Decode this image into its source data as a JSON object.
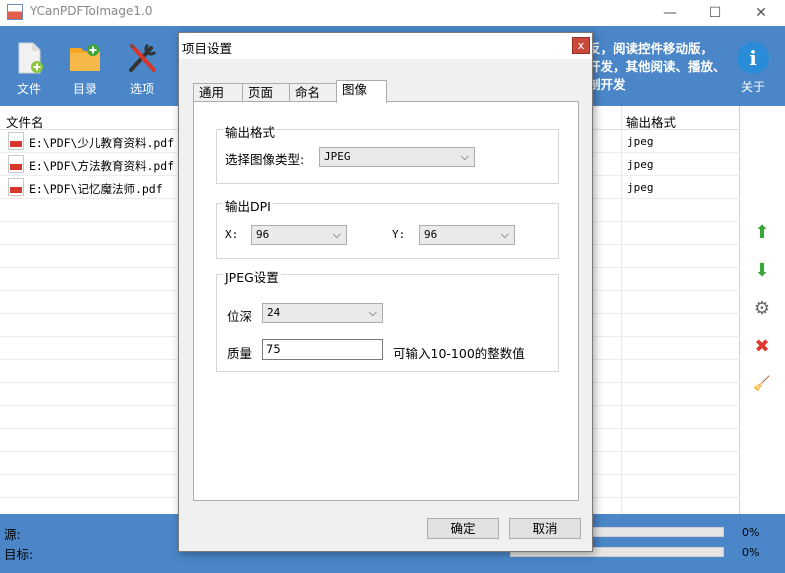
{
  "window": {
    "title": "YCanPDFToImage1.0",
    "minimize": "—",
    "maximize": "☐",
    "close": "✕"
  },
  "toolbar": {
    "file_label": "文件",
    "dir_label": "目录",
    "options_label": "选项",
    "about_label": "关于",
    "about_icon_glyph": "i",
    "banner_lines": [
      "反，阅读控件移动版，",
      "开发，其他阅读、播放、",
      "制开发"
    ]
  },
  "file_list": {
    "columns": [
      "文件名",
      "输出格式"
    ],
    "rows": [
      {
        "name": "E:\\PDF\\少儿教育资料.pdf",
        "format": "jpeg"
      },
      {
        "name": "E:\\PDF\\方法教育资料.pdf",
        "format": "jpeg"
      },
      {
        "name": "E:\\PDF\\记忆魔法师.pdf",
        "format": "jpeg"
      }
    ]
  },
  "sidebar": {
    "icons": [
      "arrow-up-icon",
      "arrow-down-icon",
      "gear-icon",
      "remove-icon",
      "clear-icon"
    ],
    "glyphs": {
      "up": "⬆",
      "down": "⬇",
      "gear": "⚙",
      "remove": "✖",
      "clear": "🧹"
    }
  },
  "status": {
    "source_label": "源:",
    "target_label": "目标:",
    "source_progress": "0%",
    "target_progress": "0%"
  },
  "dialog": {
    "title": "项目设置",
    "close": "x",
    "tabs": [
      "通用",
      "页面",
      "命名",
      "图像"
    ],
    "active_tab": "图像",
    "output_format": {
      "legend": "输出格式",
      "label": "选择图像类型:",
      "value": "JPEG"
    },
    "output_dpi": {
      "legend": "输出DPI",
      "x_label": "X:",
      "x_value": "96",
      "y_label": "Y:",
      "y_value": "96"
    },
    "jpeg_settings": {
      "legend": "JPEG设置",
      "depth_label": "位深",
      "depth_value": "24",
      "quality_label": "质量",
      "quality_value": "75",
      "quality_hint": "可输入10-100的整数值"
    },
    "ok_label": "确定",
    "cancel_label": "取消"
  },
  "colors": {
    "toolbar_bg": "#4a86c8",
    "close_btn": "#c94a3b",
    "arrow_green": "#3aa53a",
    "remove_red": "#e03a2f"
  }
}
